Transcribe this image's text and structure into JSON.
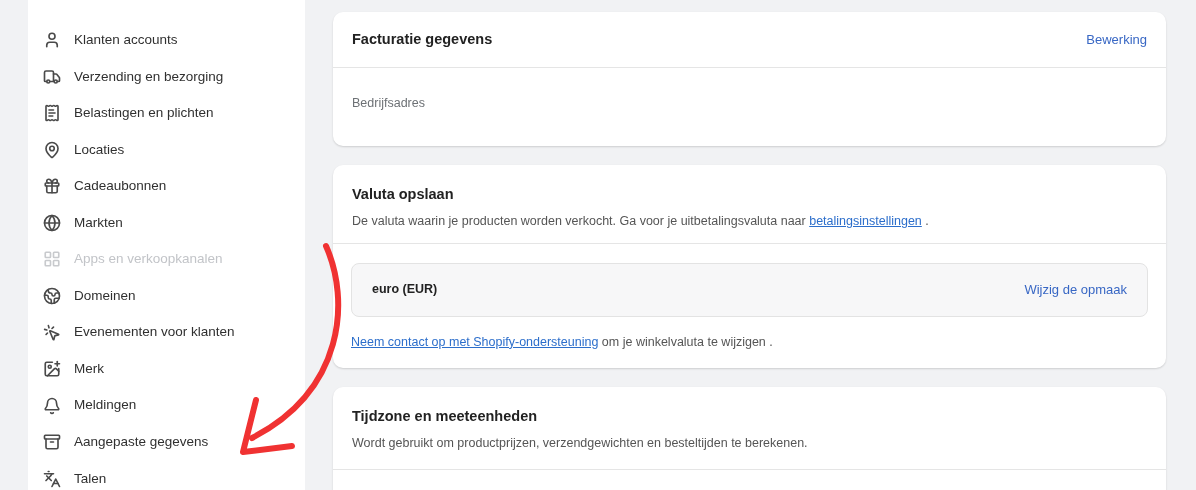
{
  "sidebar": {
    "items": [
      {
        "label": "Klanten accounts",
        "disabled": false
      },
      {
        "label": "Verzending en bezorging",
        "disabled": false
      },
      {
        "label": "Belastingen en plichten",
        "disabled": false
      },
      {
        "label": "Locaties",
        "disabled": false
      },
      {
        "label": "Cadeaubonnen",
        "disabled": false
      },
      {
        "label": "Markten",
        "disabled": false
      },
      {
        "label": "Apps en verkoopkanalen",
        "disabled": true
      },
      {
        "label": "Domeinen",
        "disabled": false
      },
      {
        "label": "Evenementen voor klanten",
        "disabled": false
      },
      {
        "label": "Merk",
        "disabled": false
      },
      {
        "label": "Meldingen",
        "disabled": false
      },
      {
        "label": "Aangepaste gegevens",
        "disabled": false
      },
      {
        "label": "Talen",
        "disabled": false
      }
    ]
  },
  "billing": {
    "title": "Facturatie gegevens",
    "action": "Bewerking",
    "label": "Bedrijfsadres"
  },
  "currency": {
    "title": "Valuta opslaan",
    "description": "De valuta waarin je producten worden verkocht. Ga voor je uitbetalingsvaluta naar",
    "description_link": "betalingsinstellingen",
    "description_end": ".",
    "value": "euro (EUR)",
    "action": "Wijzig de opmaak",
    "contact_link": "Neem contact op met Shopify-ondersteuning",
    "contact_text": "om je winkelvaluta te wijzigen ."
  },
  "timezone": {
    "title": "Tijdzone en meeteenheden",
    "description": "Wordt gebruikt om productprijzen, verzendgewichten en besteltijden te berekenen."
  }
}
